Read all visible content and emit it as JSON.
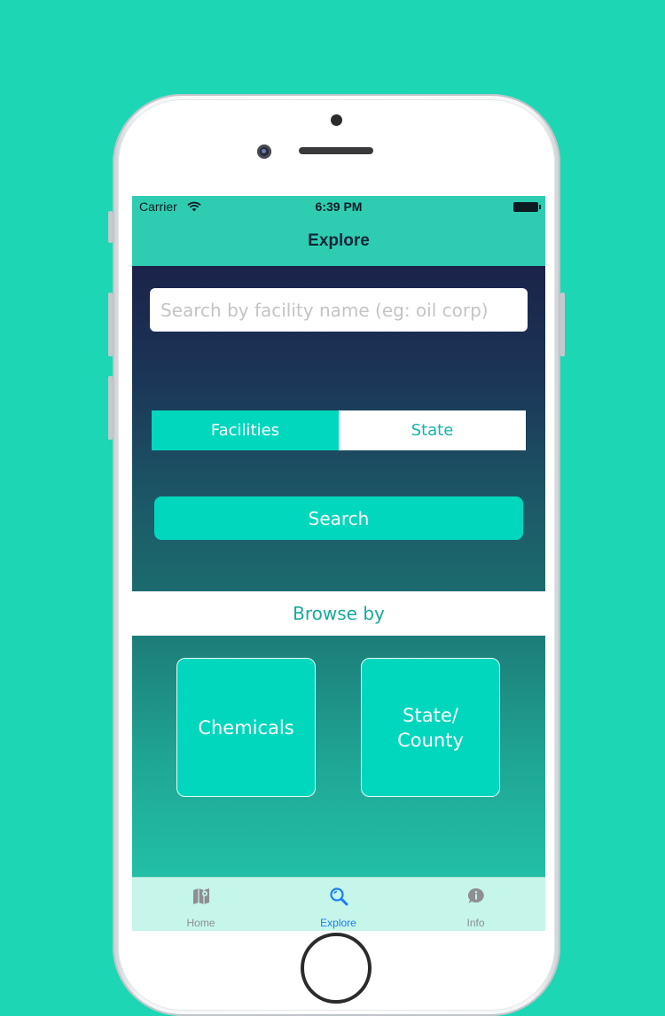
{
  "status_bar": {
    "carrier": "Carrier",
    "time": "6:39 PM"
  },
  "nav": {
    "title": "Explore"
  },
  "search": {
    "placeholder": "Search by facility name (eg: oil corp)",
    "segments": [
      {
        "label": "Facilities",
        "selected": true
      },
      {
        "label": "State",
        "selected": false
      }
    ],
    "button_label": "Search"
  },
  "browse": {
    "header": "Browse by",
    "tiles": [
      {
        "label": "Chemicals"
      },
      {
        "label": "State/\nCounty"
      }
    ]
  },
  "tab_bar": {
    "items": [
      {
        "label": "Home",
        "icon": "map-icon",
        "active": false
      },
      {
        "label": "Explore",
        "icon": "search-icon",
        "active": true
      },
      {
        "label": "Info",
        "icon": "info-bubble-icon",
        "active": false
      }
    ]
  },
  "colors": {
    "background": "#1dd6b4",
    "accent": "#00d7bd",
    "nav_bar": "#2ecdb2",
    "tab_active": "#1b7ff5",
    "tab_inactive": "#8e8e93"
  }
}
